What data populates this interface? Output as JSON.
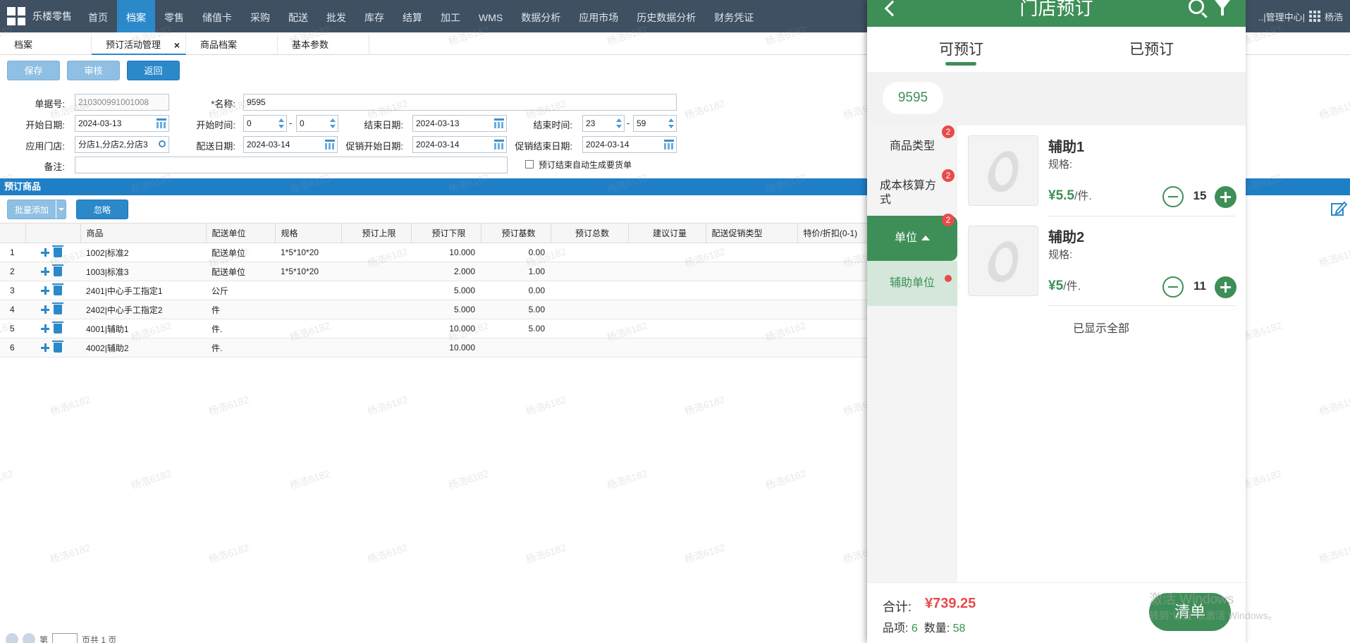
{
  "app": {
    "brand": "乐楼零售"
  },
  "nav": {
    "items": [
      "首页",
      "档案",
      "零售",
      "储值卡",
      "采购",
      "配送",
      "批发",
      "库存",
      "结算",
      "加工",
      "WMS",
      "数据分析",
      "应用市场",
      "历史数据分析",
      "财务凭证"
    ],
    "right_text": "..|管理中心|",
    "user": "杨浩"
  },
  "tabs": {
    "home": "档案",
    "active": "预订活动管理",
    "t3": "商品档案",
    "t4": "基本参数"
  },
  "toolbar": {
    "save": "保存",
    "audit": "审核",
    "back": "返回"
  },
  "form": {
    "order_no_label": "单据号:",
    "order_no": "210300991001008",
    "name_label": "*名称:",
    "name": "9595",
    "start_date_label": "开始日期:",
    "start_date": "2024-03-13",
    "start_time_label": "开始时间:",
    "start_h": "0",
    "start_m": "0",
    "end_date_label": "结束日期:",
    "end_date": "2024-03-13",
    "end_time_label": "结束时间:",
    "end_h": "23",
    "end_m": "59",
    "store_label": "应用门店:",
    "store": "分店1,分店2,分店3",
    "delivery_date_label": "配送日期:",
    "delivery_date": "2024-03-14",
    "promo_start_label": "促销开始日期:",
    "promo_start": "2024-03-14",
    "promo_end_label": "促销结束日期:",
    "promo_end": "2024-03-14",
    "remark_label": "备注:",
    "remark": "",
    "auto_label": "预订结束自动生成要货单",
    "dash": "-"
  },
  "section": {
    "title": "预订商品"
  },
  "grid_tools": {
    "batch_add": "批量添加",
    "ignore": "忽略"
  },
  "table": {
    "headers": [
      "",
      "",
      "商品",
      "配送单位",
      "规格",
      "预订上限",
      "预订下限",
      "预订基数",
      "预订总数",
      "建议订量",
      "配送促销类型",
      "特价/折扣(0-1)"
    ],
    "rows": [
      {
        "idx": "1",
        "product": "1002|标准2",
        "unit": "配送单位",
        "spec": "1*5*10*20",
        "upper": "",
        "lower": "10.000",
        "base": "0.00"
      },
      {
        "idx": "2",
        "product": "1003|标准3",
        "unit": "配送单位",
        "spec": "1*5*10*20",
        "upper": "",
        "lower": "2.000",
        "base": "1.00"
      },
      {
        "idx": "3",
        "product": "2401|中心手工指定1",
        "unit": "公斤",
        "spec": "",
        "upper": "",
        "lower": "5.000",
        "base": "0.00"
      },
      {
        "idx": "4",
        "product": "2402|中心手工指定2",
        "unit": "件",
        "spec": "",
        "upper": "",
        "lower": "5.000",
        "base": "5.00"
      },
      {
        "idx": "5",
        "product": "4001|辅助1",
        "unit": "件.",
        "spec": "",
        "upper": "",
        "lower": "10.000",
        "base": "5.00"
      },
      {
        "idx": "6",
        "product": "4002|辅助2",
        "unit": "件.",
        "spec": "",
        "upper": "",
        "lower": "10.000",
        "base": ""
      }
    ]
  },
  "pager": {
    "page_prefix": "第",
    "page_suffix": "页共 1 页"
  },
  "watermark": "杨浩6182",
  "mobile": {
    "title": "门店预订",
    "tab_available": "可预订",
    "tab_booked": "已预订",
    "chip": "9595",
    "side": [
      {
        "label": "商品类型",
        "badge": "2"
      },
      {
        "label": "成本核算方式",
        "badge": "2"
      },
      {
        "label": "单位",
        "badge": "2"
      },
      {
        "label": "辅助单位"
      }
    ],
    "products": [
      {
        "name": "辅助1",
        "spec": "规格:",
        "price": "¥5.5",
        "per": "/件.",
        "qty": "15"
      },
      {
        "name": "辅助2",
        "spec": "规格:",
        "price": "¥5",
        "per": "/件.",
        "qty": "11"
      }
    ],
    "all_shown": "已显示全部",
    "total_label": "合计:",
    "total": "¥739.25",
    "items_label": "品项:",
    "items": "6",
    "qty_label": "数量:",
    "qty": "58",
    "order_button": "清单"
  },
  "os": {
    "activate_title": "激活 Windows",
    "activate_sub": "转到\"设置\"以激活 Windows。"
  },
  "colors": {
    "nav_bg": "#3f5063",
    "accent": "#2b89c9",
    "mobile_green": "#3e8f57",
    "alert_red": "#e84a4a"
  }
}
